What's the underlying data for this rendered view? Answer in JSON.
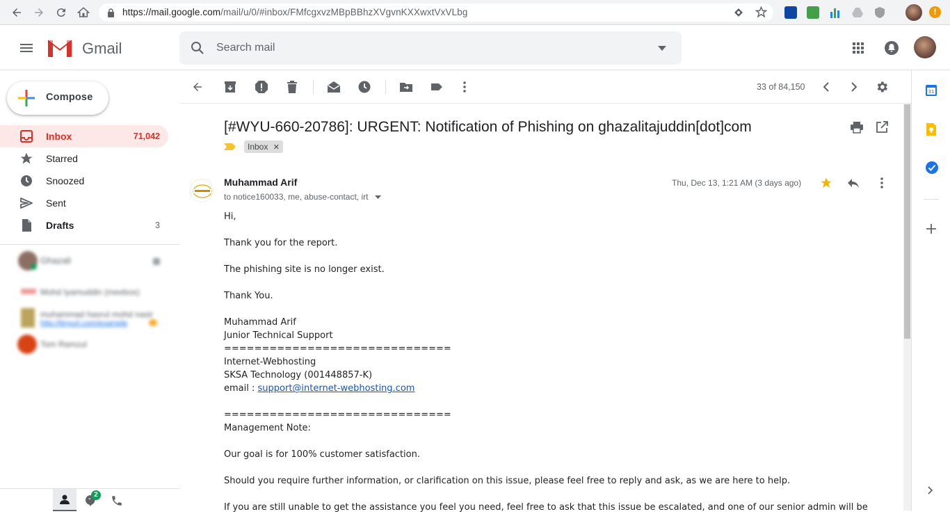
{
  "browser": {
    "url_prefix": "https://mail.google.com",
    "url_path": "/mail/u/0/#inbox/FMfcgxvzMBpBBhzXVgvnKXXwxtVxVLbg"
  },
  "header": {
    "app_name": "Gmail",
    "search_placeholder": "Search mail"
  },
  "sidebar": {
    "compose_label": "Compose",
    "items": [
      {
        "label": "Inbox",
        "count": "71,042"
      },
      {
        "label": "Starred",
        "count": ""
      },
      {
        "label": "Snoozed",
        "count": ""
      },
      {
        "label": "Sent",
        "count": ""
      },
      {
        "label": "Drafts",
        "count": "3"
      }
    ],
    "hangouts": [
      {
        "name": "Ghazali",
        "sub": ""
      },
      {
        "name": "Mohd Iyamuddin (meebox)",
        "sub": ""
      },
      {
        "name": "muhammad hasrul mohd nasir",
        "sub": "http://tinyurl.com/example"
      },
      {
        "name": "Tom Ramzul",
        "sub": ""
      }
    ],
    "hangouts_badge": "2"
  },
  "toolbar": {
    "pager": "33 of 84,150"
  },
  "message": {
    "subject": "[#WYU-660-20786]: URGENT: Notification of Phishing on ghazalitajuddin[dot]com",
    "label": "Inbox",
    "sender": "Muhammad Arif",
    "recipients": "to notice160033, me, abuse-contact, irt",
    "date": "Thu, Dec 13, 1:21 AM (3 days ago)",
    "body": {
      "greeting": "Hi,",
      "p1": "Thank you for the report.",
      "p2": "The phishing site is no longer exist.",
      "p3": "Thank You.",
      "sig_name": "Muhammad Arif",
      "sig_title": "Junior Technical Support",
      "sep1": "==============================",
      "company": "Internet-Webhosting",
      "company2": "SKSA Technology (001448857-K)",
      "email_prefix": "email : ",
      "email": "support@internet-webhosting.com",
      "sep2": "==============================",
      "mgmt": "Management Note:",
      "p4": "Our goal is for 100% customer satisfaction.",
      "p5": "Should you require further information, or clarification on this issue, please feel free to reply and ask, as we are here to help.",
      "p6": "If you are still unable to get the assistance you feel you need, feel free to ask that this issue be escalated, and one of our senior admin will be"
    }
  },
  "colors": {
    "accent_red": "#d93025",
    "active_bg": "#fce8e6",
    "link": "#1155cc",
    "star": "#f4b400"
  }
}
